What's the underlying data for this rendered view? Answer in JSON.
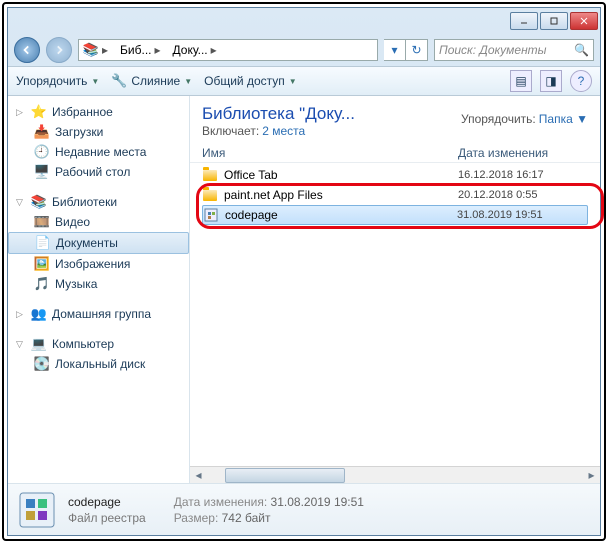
{
  "titlebar": {},
  "nav": {
    "crumbs": [
      "Биб...",
      "Доку..."
    ],
    "search_placeholder": "Поиск: Документы"
  },
  "toolbar": {
    "organize": "Упорядочить",
    "merge": "Слияние",
    "share": "Общий доступ"
  },
  "sidebar": {
    "favorites": "Избранное",
    "fav_items": [
      "Загрузки",
      "Недавние места",
      "Рабочий стол"
    ],
    "libraries": "Библиотеки",
    "lib_items": [
      "Видео",
      "Документы",
      "Изображения",
      "Музыка"
    ],
    "homegroup": "Домашняя группа",
    "computer": "Компьютер",
    "comp_items": [
      "Локальный диск"
    ]
  },
  "main": {
    "lib_title": "Библиотека \"Доку...",
    "lib_sub_label": "Включает:",
    "lib_sub_link": "2 места",
    "sort_label": "Упорядочить:",
    "sort_value": "Папка",
    "col_name": "Имя",
    "col_date": "Дата изменения",
    "rows": [
      {
        "name": "Office Tab",
        "date": "16.12.2018 16:17",
        "type": "folder"
      },
      {
        "name": "paint.net App Files",
        "date": "20.12.2018 0:55",
        "type": "folder"
      },
      {
        "name": "codepage",
        "date": "31.08.2019 19:51",
        "type": "reg"
      }
    ]
  },
  "details": {
    "name": "codepage",
    "type": "Файл реестра",
    "date_label": "Дата изменения:",
    "date": "31.08.2019 19:51",
    "size_label": "Размер:",
    "size": "742 байт"
  }
}
